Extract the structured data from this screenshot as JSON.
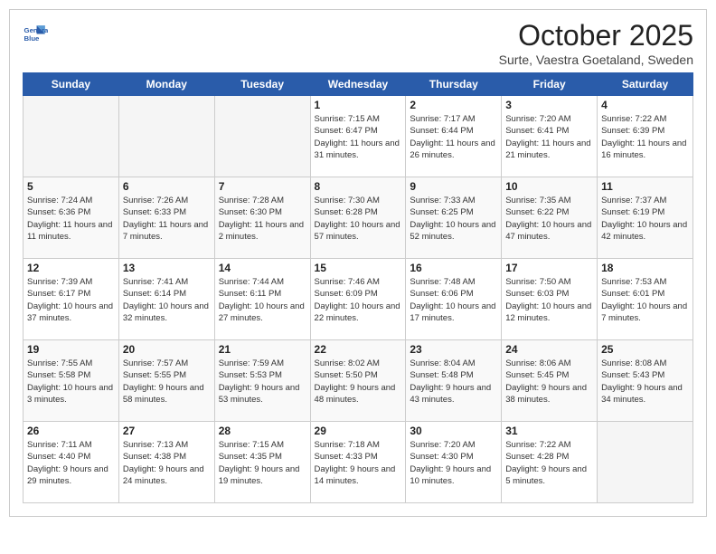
{
  "header": {
    "logo_line1": "General",
    "logo_line2": "Blue",
    "title": "October 2025",
    "subtitle": "Surte, Vaestra Goetaland, Sweden"
  },
  "day_headers": [
    "Sunday",
    "Monday",
    "Tuesday",
    "Wednesday",
    "Thursday",
    "Friday",
    "Saturday"
  ],
  "weeks": [
    [
      {
        "day": "",
        "empty": true
      },
      {
        "day": "",
        "empty": true
      },
      {
        "day": "",
        "empty": true
      },
      {
        "day": "1",
        "sunrise": "Sunrise: 7:15 AM",
        "sunset": "Sunset: 6:47 PM",
        "daylight": "Daylight: 11 hours and 31 minutes."
      },
      {
        "day": "2",
        "sunrise": "Sunrise: 7:17 AM",
        "sunset": "Sunset: 6:44 PM",
        "daylight": "Daylight: 11 hours and 26 minutes."
      },
      {
        "day": "3",
        "sunrise": "Sunrise: 7:20 AM",
        "sunset": "Sunset: 6:41 PM",
        "daylight": "Daylight: 11 hours and 21 minutes."
      },
      {
        "day": "4",
        "sunrise": "Sunrise: 7:22 AM",
        "sunset": "Sunset: 6:39 PM",
        "daylight": "Daylight: 11 hours and 16 minutes."
      }
    ],
    [
      {
        "day": "5",
        "sunrise": "Sunrise: 7:24 AM",
        "sunset": "Sunset: 6:36 PM",
        "daylight": "Daylight: 11 hours and 11 minutes."
      },
      {
        "day": "6",
        "sunrise": "Sunrise: 7:26 AM",
        "sunset": "Sunset: 6:33 PM",
        "daylight": "Daylight: 11 hours and 7 minutes."
      },
      {
        "day": "7",
        "sunrise": "Sunrise: 7:28 AM",
        "sunset": "Sunset: 6:30 PM",
        "daylight": "Daylight: 11 hours and 2 minutes."
      },
      {
        "day": "8",
        "sunrise": "Sunrise: 7:30 AM",
        "sunset": "Sunset: 6:28 PM",
        "daylight": "Daylight: 10 hours and 57 minutes."
      },
      {
        "day": "9",
        "sunrise": "Sunrise: 7:33 AM",
        "sunset": "Sunset: 6:25 PM",
        "daylight": "Daylight: 10 hours and 52 minutes."
      },
      {
        "day": "10",
        "sunrise": "Sunrise: 7:35 AM",
        "sunset": "Sunset: 6:22 PM",
        "daylight": "Daylight: 10 hours and 47 minutes."
      },
      {
        "day": "11",
        "sunrise": "Sunrise: 7:37 AM",
        "sunset": "Sunset: 6:19 PM",
        "daylight": "Daylight: 10 hours and 42 minutes."
      }
    ],
    [
      {
        "day": "12",
        "sunrise": "Sunrise: 7:39 AM",
        "sunset": "Sunset: 6:17 PM",
        "daylight": "Daylight: 10 hours and 37 minutes."
      },
      {
        "day": "13",
        "sunrise": "Sunrise: 7:41 AM",
        "sunset": "Sunset: 6:14 PM",
        "daylight": "Daylight: 10 hours and 32 minutes."
      },
      {
        "day": "14",
        "sunrise": "Sunrise: 7:44 AM",
        "sunset": "Sunset: 6:11 PM",
        "daylight": "Daylight: 10 hours and 27 minutes."
      },
      {
        "day": "15",
        "sunrise": "Sunrise: 7:46 AM",
        "sunset": "Sunset: 6:09 PM",
        "daylight": "Daylight: 10 hours and 22 minutes."
      },
      {
        "day": "16",
        "sunrise": "Sunrise: 7:48 AM",
        "sunset": "Sunset: 6:06 PM",
        "daylight": "Daylight: 10 hours and 17 minutes."
      },
      {
        "day": "17",
        "sunrise": "Sunrise: 7:50 AM",
        "sunset": "Sunset: 6:03 PM",
        "daylight": "Daylight: 10 hours and 12 minutes."
      },
      {
        "day": "18",
        "sunrise": "Sunrise: 7:53 AM",
        "sunset": "Sunset: 6:01 PM",
        "daylight": "Daylight: 10 hours and 7 minutes."
      }
    ],
    [
      {
        "day": "19",
        "sunrise": "Sunrise: 7:55 AM",
        "sunset": "Sunset: 5:58 PM",
        "daylight": "Daylight: 10 hours and 3 minutes."
      },
      {
        "day": "20",
        "sunrise": "Sunrise: 7:57 AM",
        "sunset": "Sunset: 5:55 PM",
        "daylight": "Daylight: 9 hours and 58 minutes."
      },
      {
        "day": "21",
        "sunrise": "Sunrise: 7:59 AM",
        "sunset": "Sunset: 5:53 PM",
        "daylight": "Daylight: 9 hours and 53 minutes."
      },
      {
        "day": "22",
        "sunrise": "Sunrise: 8:02 AM",
        "sunset": "Sunset: 5:50 PM",
        "daylight": "Daylight: 9 hours and 48 minutes."
      },
      {
        "day": "23",
        "sunrise": "Sunrise: 8:04 AM",
        "sunset": "Sunset: 5:48 PM",
        "daylight": "Daylight: 9 hours and 43 minutes."
      },
      {
        "day": "24",
        "sunrise": "Sunrise: 8:06 AM",
        "sunset": "Sunset: 5:45 PM",
        "daylight": "Daylight: 9 hours and 38 minutes."
      },
      {
        "day": "25",
        "sunrise": "Sunrise: 8:08 AM",
        "sunset": "Sunset: 5:43 PM",
        "daylight": "Daylight: 9 hours and 34 minutes."
      }
    ],
    [
      {
        "day": "26",
        "sunrise": "Sunrise: 7:11 AM",
        "sunset": "Sunset: 4:40 PM",
        "daylight": "Daylight: 9 hours and 29 minutes."
      },
      {
        "day": "27",
        "sunrise": "Sunrise: 7:13 AM",
        "sunset": "Sunset: 4:38 PM",
        "daylight": "Daylight: 9 hours and 24 minutes."
      },
      {
        "day": "28",
        "sunrise": "Sunrise: 7:15 AM",
        "sunset": "Sunset: 4:35 PM",
        "daylight": "Daylight: 9 hours and 19 minutes."
      },
      {
        "day": "29",
        "sunrise": "Sunrise: 7:18 AM",
        "sunset": "Sunset: 4:33 PM",
        "daylight": "Daylight: 9 hours and 14 minutes."
      },
      {
        "day": "30",
        "sunrise": "Sunrise: 7:20 AM",
        "sunset": "Sunset: 4:30 PM",
        "daylight": "Daylight: 9 hours and 10 minutes."
      },
      {
        "day": "31",
        "sunrise": "Sunrise: 7:22 AM",
        "sunset": "Sunset: 4:28 PM",
        "daylight": "Daylight: 9 hours and 5 minutes."
      },
      {
        "day": "",
        "empty": true
      }
    ]
  ]
}
